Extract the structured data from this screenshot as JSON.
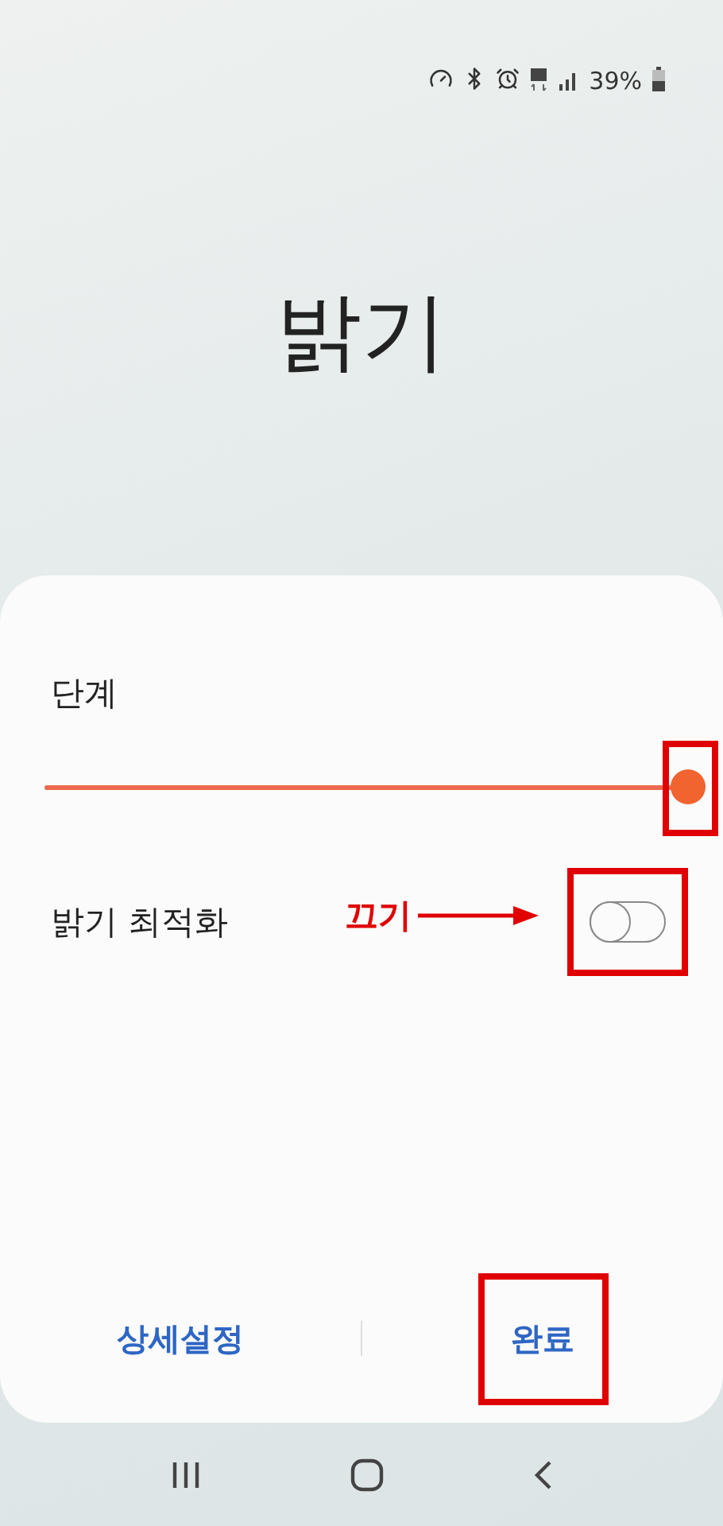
{
  "status_bar": {
    "battery": "39%"
  },
  "title": "밝기",
  "panel": {
    "level_label": "단계",
    "brightness": {
      "level": 1.0,
      "highlighted": true
    },
    "adaptive": {
      "label": "밝기 최적화",
      "on": false,
      "highlighted": true,
      "callout": "끄기"
    },
    "buttons": [
      {
        "label": "상세설정",
        "highlighted": false
      },
      {
        "label": "완료",
        "highlighted": true
      }
    ]
  }
}
